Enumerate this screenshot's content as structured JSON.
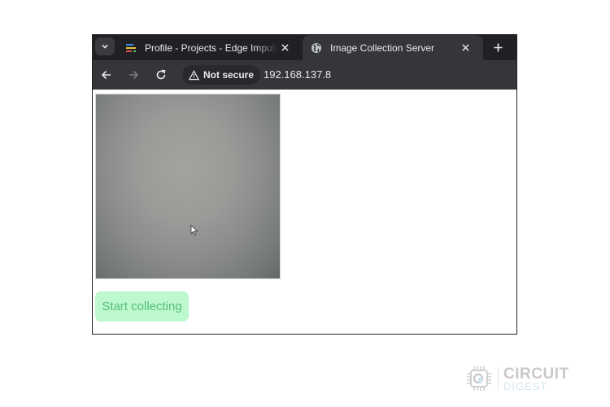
{
  "browser": {
    "tabs": [
      {
        "title": "Profile - Projects - Edge Impulse",
        "favicon": "edge-impulse-icon",
        "active": false
      },
      {
        "title": "Image Collection Server",
        "favicon": "globe-icon",
        "active": true
      }
    ],
    "toolbar": {
      "security_label": "Not secure",
      "url": "192.168.137.8"
    },
    "icons": {
      "tab_search": "chevron-down-icon",
      "new_tab": "plus-icon",
      "back": "arrow-left-icon",
      "forward": "arrow-right-icon",
      "reload": "reload-icon",
      "warning": "warning-triangle-icon"
    }
  },
  "page": {
    "camera_feed": {
      "label": "camera-stream"
    },
    "collect_button": {
      "label": "Start collecting",
      "color_bg": "#bdf8cf",
      "color_text": "#55bf78"
    }
  },
  "watermark": {
    "line1": "CIRCUIT",
    "line2": "DIGEST"
  }
}
